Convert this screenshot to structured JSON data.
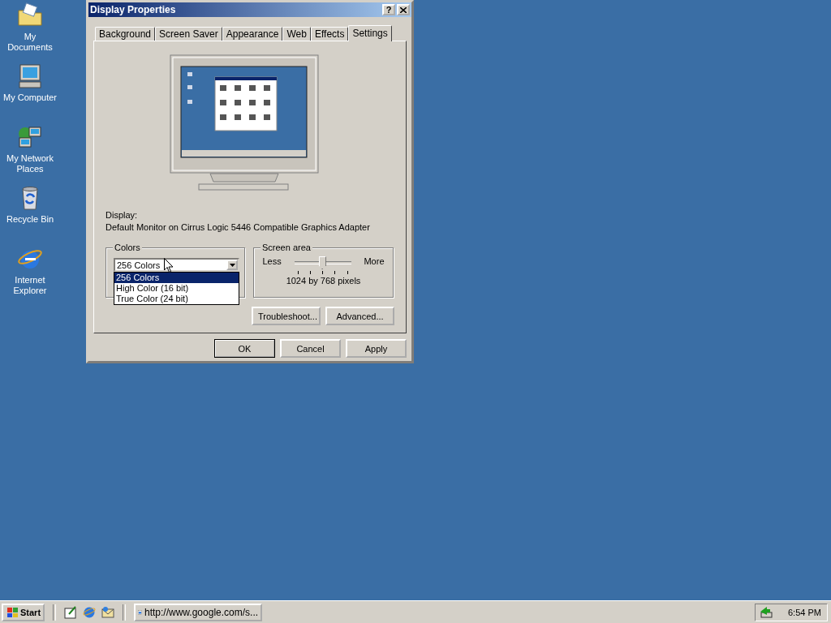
{
  "desktop_icons": [
    {
      "label": "My Documents",
      "kind": "documents"
    },
    {
      "label": "My Computer",
      "kind": "computer"
    },
    {
      "label": "My Network Places",
      "kind": "network"
    },
    {
      "label": "Recycle Bin",
      "kind": "recycle"
    },
    {
      "label": "Internet Explorer",
      "kind": "browser"
    }
  ],
  "window": {
    "title": "Display Properties",
    "help_button": "?",
    "tabs": [
      {
        "label": "Background",
        "selected": false
      },
      {
        "label": "Screen Saver",
        "selected": false
      },
      {
        "label": "Appearance",
        "selected": false
      },
      {
        "label": "Web",
        "selected": false
      },
      {
        "label": "Effects",
        "selected": false
      },
      {
        "label": "Settings",
        "selected": true
      }
    ],
    "display_label": "Display:",
    "display_value": "Default Monitor on Cirrus Logic 5446 Compatible Graphics Adapter",
    "colors": {
      "legend": "Colors",
      "value": "256 Colors",
      "expanded": true,
      "options": [
        {
          "label": "256 Colors",
          "selected": true
        },
        {
          "label": "High Color (16 bit)",
          "selected": false
        },
        {
          "label": "True Color (24 bit)",
          "selected": false
        }
      ]
    },
    "screen_area": {
      "legend": "Screen area",
      "less": "Less",
      "more": "More",
      "level": 0.5,
      "reading": "1024 by 768 pixels"
    },
    "buttons": [
      "Troubleshoot...",
      "Advanced..."
    ],
    "dialog_buttons": [
      {
        "label": "OK",
        "default": true
      },
      {
        "label": "Cancel",
        "default": false
      },
      {
        "label": "Apply",
        "default": false
      }
    ]
  },
  "taskbar": {
    "start": "Start",
    "task": "http://www.google.com/s...",
    "clock": "6:54 PM"
  }
}
